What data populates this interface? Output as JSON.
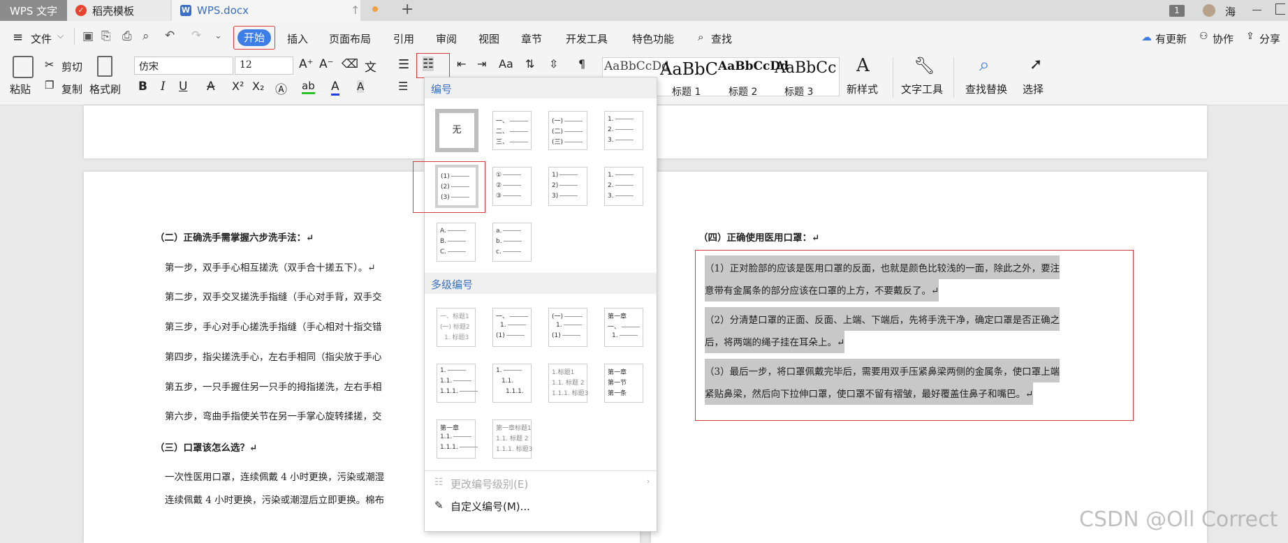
{
  "titlebar": {
    "app_tab": "WPS 文字",
    "template_tab": "稻壳模板",
    "doc_tab": "WPS.docx",
    "new_tab": "+",
    "badge": "1",
    "user": "海"
  },
  "menubar": {
    "file": "文件",
    "items": [
      "开始",
      "插入",
      "页面布局",
      "引用",
      "审阅",
      "视图",
      "章节",
      "开发工具",
      "特色功能",
      "查找"
    ],
    "right": [
      "有更新",
      "协作",
      "分享"
    ]
  },
  "ribbon": {
    "paste": "粘贴",
    "cut": "剪切",
    "copy": "复制",
    "format_painter": "格式刷",
    "font": "仿宋",
    "size": "12",
    "styles": [
      {
        "sample": "AaBbCcDd",
        "label": ""
      },
      {
        "sample": "AaBbC",
        "label": "标题 1"
      },
      {
        "sample": "AaBbCcDd",
        "label": "标题 2"
      },
      {
        "sample": "AaBbCc",
        "label": "标题 3"
      }
    ],
    "new_style": "新样式",
    "text_tools": "文字工具",
    "find_replace": "查找替换",
    "select": "选择"
  },
  "doc_left": {
    "heading2": "（二）正确洗手需掌握六步洗手法：↵",
    "steps": [
      "第一步，双手手心相互搓洗（双手合十搓五下）。↵",
      "第二步，双手交叉搓洗手指缝（手心对手背，双手交",
      "第三步，手心对手心搓洗手指缝（手心相对十指交错",
      "第四步，指尖搓洗手心，左右手相同（指尖放于手心",
      "第五步，一只手握住另一只手的拇指搓洗，左右手相",
      "第六步，弯曲手指使关节在另一手掌心旋转揉搓，交"
    ],
    "heading3": "（三）口罩该怎么选？↵",
    "para1": "一次性医用口罩，连续佩戴 4 小时更换，污染或潮湿",
    "para2": "连续佩戴 4 小时更换，污染或潮湿后立即更换。棉布"
  },
  "doc_right": {
    "heading4": "（四）正确使用医用口罩：↵",
    "lines": [
      "（1）正对脸部的应该是医用口罩的反面，也就是颜色比较浅的一面，除此之外，要注",
      "意带有金属条的部分应该在口罩的上方，不要戴反了。↵",
      "（2）分清楚口罩的正面、反面、上端、下端后，先将手洗干净，确定口罩是否正确之",
      "后，将两端的绳子挂在耳朵上。↵",
      "（3）最后一步，将口罩佩戴完毕后，需要用双手压紧鼻梁两侧的金属条，使口罩上端",
      "紧贴鼻梁，然后向下拉伸口罩，使口罩不留有褶皱，最好覆盖住鼻子和嘴巴。↵"
    ]
  },
  "numbering": {
    "section1": "编号",
    "none": "无",
    "section2": "多级编号",
    "change_level": "更改编号级别(E)",
    "custom": "自定义编号(M)...",
    "opt_a": [
      "一、",
      "二、",
      "三、"
    ],
    "opt_b": [
      "(一)",
      "(二)",
      "(三)"
    ],
    "opt_c": [
      "1.",
      "2.",
      "3."
    ],
    "opt_d": [
      "(1)",
      "(2)",
      "(3)"
    ],
    "opt_e": [
      "①",
      "②",
      "③"
    ],
    "opt_f": [
      "1)",
      "2)",
      "3)"
    ],
    "opt_g": [
      "1.",
      "2.",
      "3."
    ],
    "opt_h": [
      "A.",
      "B.",
      "C."
    ],
    "opt_i": [
      "a.",
      "b.",
      "c."
    ],
    "ml1": [
      "一、标题1",
      "(一) 标题2",
      "1. 标题3"
    ],
    "ml2": [
      "一、",
      "1.",
      "(1)"
    ],
    "ml3": [
      "(一)",
      "1.",
      "(1)"
    ],
    "ml4": [
      "第一章",
      "一、",
      "1."
    ],
    "ml5": [
      "1.",
      "1.1.",
      "1.1.1."
    ],
    "ml6": [
      "1.",
      "1.1.",
      "1.1.1."
    ],
    "ml7": [
      "1.标题1",
      "1.1. 标题 2",
      "1.1.1. 标题3"
    ],
    "ml8": [
      "第一章",
      "第一节",
      "第一条"
    ],
    "ml9": [
      "第一章",
      "1.1.",
      "1.1.1."
    ],
    "ml10": [
      "第一章标题1",
      "1.1. 标题 2",
      "1.1.1. 标题3"
    ]
  },
  "watermark": "CSDN @Oll Correct"
}
